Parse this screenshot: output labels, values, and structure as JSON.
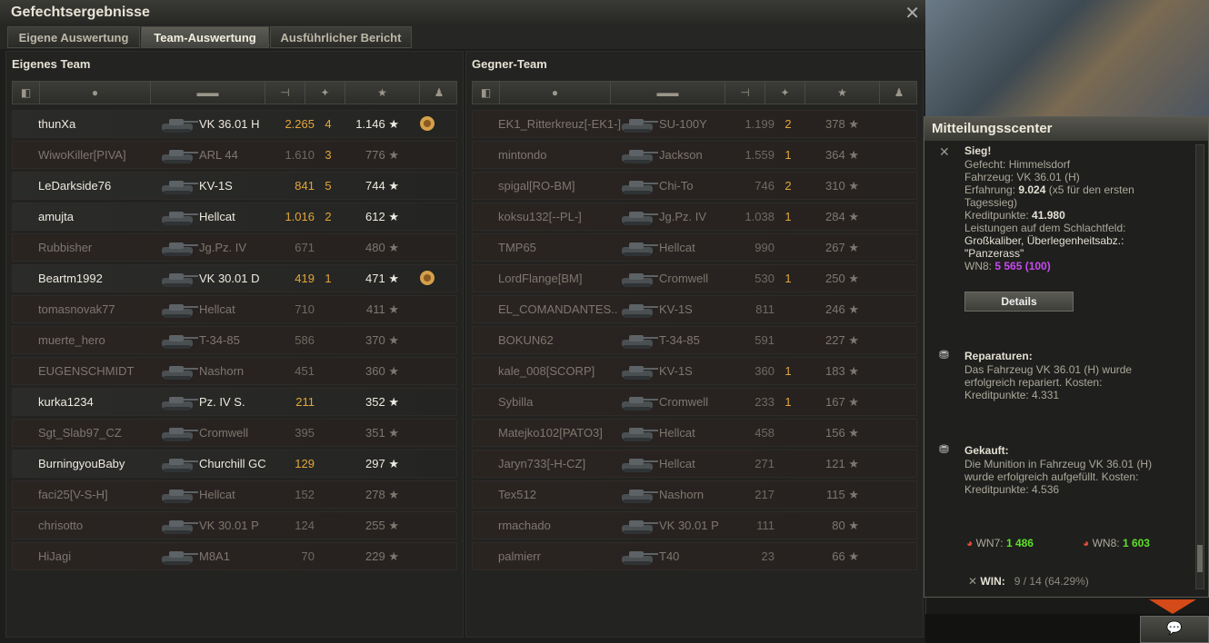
{
  "window": {
    "title": "Gefechtsergebnisse"
  },
  "tabs": [
    "Eigene Auswertung",
    "Team-Auswertung",
    "Ausführlicher Bericht"
  ],
  "own_team": {
    "title": "Eigenes Team",
    "rows": [
      {
        "player": "thunXa",
        "tank": "VK 36.01 H",
        "dmg": "2.265",
        "kills": "4",
        "xp": "1.146 ★",
        "status": "highlight",
        "medal": true
      },
      {
        "player": "WiwoKiller[PIVA]",
        "tank": "ARL 44",
        "dmg": "1.610",
        "kills": "3",
        "xp": "776 ★",
        "status": "dead",
        "medal": false
      },
      {
        "player": "LeDarkside76",
        "tank": "KV-1S",
        "dmg": "841",
        "kills": "5",
        "xp": "744 ★",
        "status": "alive",
        "medal": false
      },
      {
        "player": "amujta",
        "tank": "Hellcat",
        "dmg": "1.016",
        "kills": "2",
        "xp": "612 ★",
        "status": "alive",
        "medal": false
      },
      {
        "player": "Rubbisher",
        "tank": "Jg.Pz. IV",
        "dmg": "671",
        "kills": "",
        "xp": "480 ★",
        "status": "dead",
        "medal": false
      },
      {
        "player": "Beartm1992",
        "tank": "VK 30.01 D",
        "dmg": "419",
        "kills": "1",
        "xp": "471 ★",
        "status": "alive",
        "medal": true
      },
      {
        "player": "tomasnovak77",
        "tank": "Hellcat",
        "dmg": "710",
        "kills": "",
        "xp": "411 ★",
        "status": "dead",
        "medal": false
      },
      {
        "player": "muerte_hero",
        "tank": "T-34-85",
        "dmg": "586",
        "kills": "",
        "xp": "370 ★",
        "status": "dead",
        "medal": false
      },
      {
        "player": "EUGENSCHMIDT",
        "tank": "Nashorn",
        "dmg": "451",
        "kills": "",
        "xp": "360 ★",
        "status": "dead",
        "medal": false
      },
      {
        "player": "kurka1234",
        "tank": "Pz. IV S.",
        "dmg": "211",
        "kills": "",
        "xp": "352 ★",
        "status": "alive",
        "medal": false
      },
      {
        "player": "Sgt_Slab97_CZ",
        "tank": "Cromwell",
        "dmg": "395",
        "kills": "",
        "xp": "351 ★",
        "status": "dead",
        "medal": false
      },
      {
        "player": "BurningyouBaby",
        "tank": "Churchill GC",
        "dmg": "129",
        "kills": "",
        "xp": "297 ★",
        "status": "alive",
        "medal": false
      },
      {
        "player": "faci25[V-S-H]",
        "tank": "Hellcat",
        "dmg": "152",
        "kills": "",
        "xp": "278 ★",
        "status": "dead",
        "medal": false
      },
      {
        "player": "chrisotto",
        "tank": "VK 30.01 P",
        "dmg": "124",
        "kills": "",
        "xp": "255 ★",
        "status": "dead",
        "medal": false
      },
      {
        "player": "HiJagi",
        "tank": "M8A1",
        "dmg": "70",
        "kills": "",
        "xp": "229 ★",
        "status": "dead",
        "medal": false
      }
    ]
  },
  "enemy_team": {
    "title": "Gegner-Team",
    "rows": [
      {
        "player": "EK1_Ritterkreuz[-EK1-]",
        "tank": "SU-100Y",
        "dmg": "1.199",
        "kills": "2",
        "xp": "378 ★",
        "status": "dead"
      },
      {
        "player": "mintondo",
        "tank": "Jackson",
        "dmg": "1.559",
        "kills": "1",
        "xp": "364 ★",
        "status": "dead"
      },
      {
        "player": "spigal[RO-BM]",
        "tank": "Chi-To",
        "dmg": "746",
        "kills": "2",
        "xp": "310 ★",
        "status": "dead"
      },
      {
        "player": "koksu132[--PL-]",
        "tank": "Jg.Pz. IV",
        "dmg": "1.038",
        "kills": "1",
        "xp": "284 ★",
        "status": "dead"
      },
      {
        "player": "TMP65",
        "tank": "Hellcat",
        "dmg": "990",
        "kills": "",
        "xp": "267 ★",
        "status": "dead"
      },
      {
        "player": "LordFlange[BM]",
        "tank": "Cromwell",
        "dmg": "530",
        "kills": "1",
        "xp": "250 ★",
        "status": "dead"
      },
      {
        "player": "EL_COMANDANTES..",
        "tank": "KV-1S",
        "dmg": "811",
        "kills": "",
        "xp": "246 ★",
        "status": "dead"
      },
      {
        "player": "BOKUN62",
        "tank": "T-34-85",
        "dmg": "591",
        "kills": "",
        "xp": "227 ★",
        "status": "dead"
      },
      {
        "player": "kale_008[SCORP]",
        "tank": "KV-1S",
        "dmg": "360",
        "kills": "1",
        "xp": "183 ★",
        "status": "dead"
      },
      {
        "player": "Sybilla",
        "tank": "Cromwell",
        "dmg": "233",
        "kills": "1",
        "xp": "167 ★",
        "status": "dead"
      },
      {
        "player": "Matejko102[PATO3]",
        "tank": "Hellcat",
        "dmg": "458",
        "kills": "",
        "xp": "156 ★",
        "status": "dead"
      },
      {
        "player": "Jaryn733[-H-CZ]",
        "tank": "Hellcat",
        "dmg": "271",
        "kills": "",
        "xp": "121 ★",
        "status": "dead"
      },
      {
        "player": "Tex512",
        "tank": "Nashorn",
        "dmg": "217",
        "kills": "",
        "xp": "115 ★",
        "status": "dead"
      },
      {
        "player": "rmachado",
        "tank": "VK 30.01 P",
        "dmg": "111",
        "kills": "",
        "xp": "80 ★",
        "status": "dead"
      },
      {
        "player": "palmierr",
        "tank": "T40",
        "dmg": "23",
        "kills": "",
        "xp": "66 ★",
        "status": "dead"
      }
    ]
  },
  "message_center": {
    "title": "Mitteilungsscenter",
    "victory": {
      "heading": "Sieg!",
      "battle": "Gefecht: Himmelsdorf",
      "vehicle": "Fahrzeug: VK 36.01 (H)",
      "xp_label": "Erfahrung: ",
      "xp_value": "9.024",
      "xp_note": " (x5 für den ersten",
      "xp_note2": "Tagessieg)",
      "credits_label": "Kreditpunkte: ",
      "credits_value": "41.980",
      "perf_label": "Leistungen auf dem Schlachtfeld:",
      "perf_1": "Großkaliber, Überlegenheitsabz.:",
      "perf_2": "\"Panzerass\"",
      "wn8_label": "WN8: ",
      "wn8_value": "5 565 (100)",
      "details_button": "Details"
    },
    "repair": {
      "heading": "Reparaturen:",
      "line1": "Das Fahrzeug VK 36.01 (H) wurde",
      "line2": "erfolgreich repariert. Kosten:",
      "line3": "Kreditpunkte:  4.331"
    },
    "bought": {
      "heading": "Gekauft:",
      "line1": "Die Munition in Fahrzeug VK 36.01 (H)",
      "line2": "wurde erfolgreich aufgefüllt. Kosten:",
      "line3": "Kreditpunkte:  4.536"
    },
    "stats": {
      "wn7_label": "WN7: ",
      "wn7_value": "1 486",
      "wn8_label": "WN8: ",
      "wn8_value": "1 603",
      "win_label": "WIN:",
      "win_value": "9 / 14 (64.29%)"
    }
  },
  "colors": {
    "accent": "#e2a63a",
    "wn8_purple": "#c84af0",
    "wn_green": "#5ee02a",
    "alert_orange": "#d44a18"
  }
}
